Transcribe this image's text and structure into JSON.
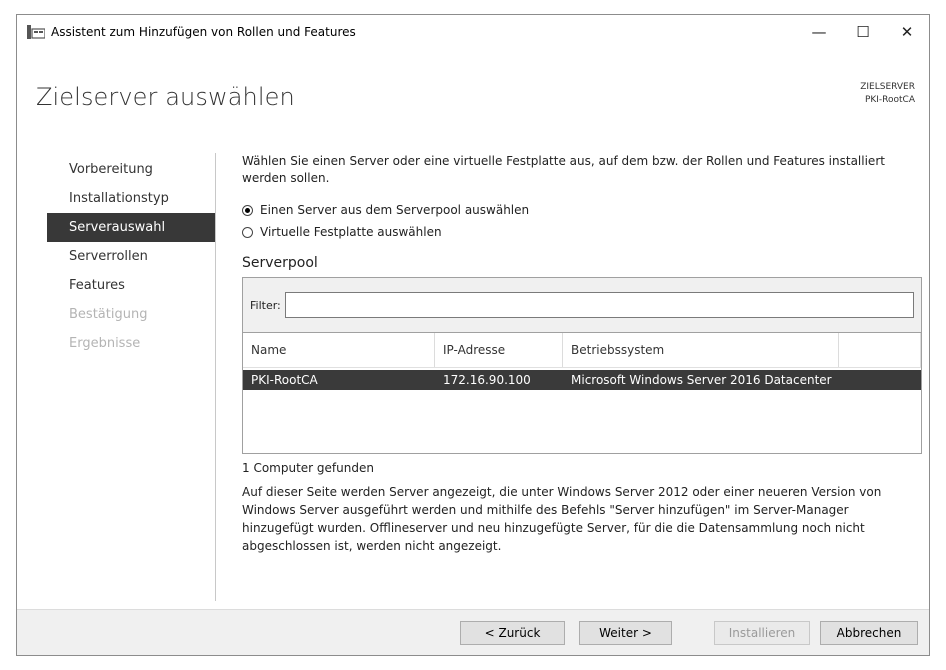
{
  "window": {
    "title": "Assistent zum Hinzufügen von Rollen und Features",
    "controls": {
      "minimize": "—",
      "maximize": "☐",
      "close": "✕"
    }
  },
  "page": {
    "heading": "Zielserver auswählen",
    "target_label": "ZIELSERVER",
    "target_name": "PKI-RootCA"
  },
  "nav": {
    "items": [
      {
        "label": "Vorbereitung",
        "state": "normal"
      },
      {
        "label": "Installationstyp",
        "state": "normal"
      },
      {
        "label": "Serverauswahl",
        "state": "active"
      },
      {
        "label": "Serverrollen",
        "state": "normal"
      },
      {
        "label": "Features",
        "state": "normal"
      },
      {
        "label": "Bestätigung",
        "state": "disabled"
      },
      {
        "label": "Ergebnisse",
        "state": "disabled"
      }
    ]
  },
  "content": {
    "intro": "Wählen Sie einen Server oder eine virtuelle Festplatte aus, auf dem bzw. der Rollen und Features installiert werden sollen.",
    "option_pool": "Einen Server aus dem Serverpool auswählen",
    "option_vhd": "Virtuelle Festplatte auswählen",
    "pool_title": "Serverpool",
    "filter_label": "Filter:",
    "filter_value": "",
    "columns": {
      "name": "Name",
      "ip": "IP-Adresse",
      "os": "Betriebssystem"
    },
    "row": {
      "name": "PKI-RootCA",
      "ip": "172.16.90.100",
      "os": "Microsoft Windows Server 2016 Datacenter"
    },
    "found": "1 Computer gefunden",
    "description": "Auf dieser Seite werden Server angezeigt, die unter Windows Server 2012 oder einer neueren Version von Windows Server ausgeführt werden und mithilfe des Befehls \"Server hinzufügen\" im Server-Manager hinzugefügt wurden. Offlineserver und neu hinzugefügte Server, für die die Datensammlung noch nicht abgeschlossen ist, werden nicht angezeigt."
  },
  "buttons": {
    "back": "< Zurück",
    "next": "Weiter >",
    "install": "Installieren",
    "cancel": "Abbrechen"
  }
}
